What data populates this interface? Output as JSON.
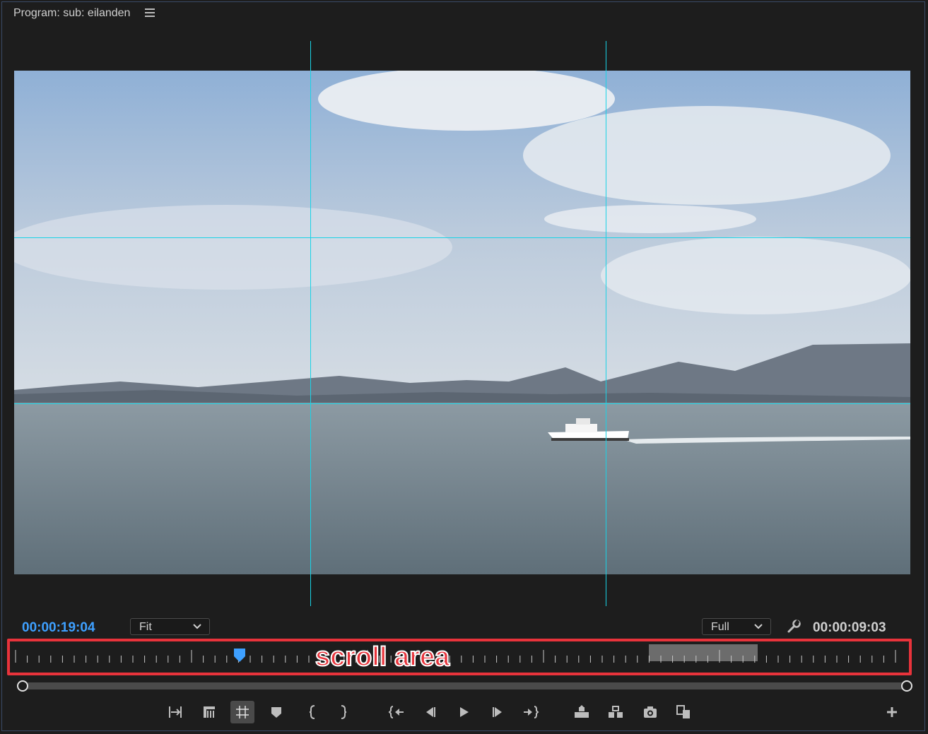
{
  "panel": {
    "title": "Program: sub: eilanden"
  },
  "timecode": {
    "current": "00:00:19:04",
    "duration": "00:00:09:03"
  },
  "zoom": {
    "selected": "Fit"
  },
  "resolution": {
    "selected": "Full"
  },
  "annotation": {
    "text": "scroll area"
  },
  "colors": {
    "guide": "#19d3e6",
    "timecode_current": "#3ea0ff",
    "annotation": "#e8333b"
  },
  "transport": {
    "buttons": [
      "mark-in-out-icon",
      "clip-marker-icon",
      "safe-margins-icon",
      "add-marker-icon",
      "mark-in-icon",
      "mark-out-icon",
      "go-to-in-icon",
      "step-back-icon",
      "play-icon",
      "step-forward-icon",
      "go-to-out-icon",
      "lift-icon",
      "extract-icon",
      "export-frame-icon",
      "comparison-view-icon",
      "add-button-icon"
    ]
  }
}
